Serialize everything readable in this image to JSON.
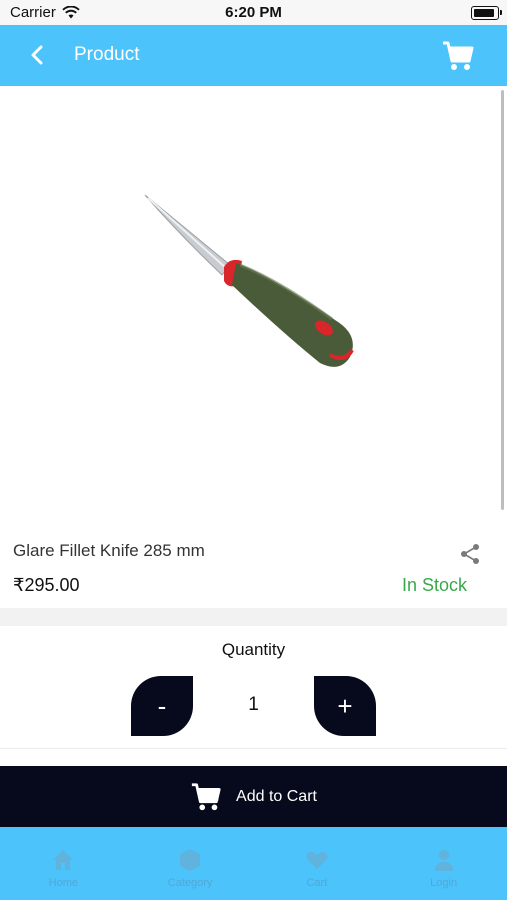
{
  "status_bar": {
    "carrier": "Carrier",
    "time": "6:20 PM"
  },
  "header": {
    "title": "Product",
    "back_icon": "chevron-left-icon",
    "cart_icon": "shopping-cart-icon"
  },
  "product": {
    "name": "Glare Fillet Knife 285 mm",
    "price": "₹295.00",
    "stock_status": "In Stock",
    "stock_color": "#3aa84a"
  },
  "quantity": {
    "label": "Quantity",
    "minus": "-",
    "value": "1",
    "plus": "+"
  },
  "add_to_cart": {
    "label": "Add to Cart"
  },
  "bottom_nav": {
    "items": [
      {
        "label": "Home",
        "icon": "home-icon"
      },
      {
        "label": "Category",
        "icon": "category-icon"
      },
      {
        "label": "Cart",
        "icon": "heart-icon"
      },
      {
        "label": "Login",
        "icon": "user-icon"
      }
    ]
  },
  "colors": {
    "accent": "#4cc3fb",
    "dark": "#070a1c"
  }
}
